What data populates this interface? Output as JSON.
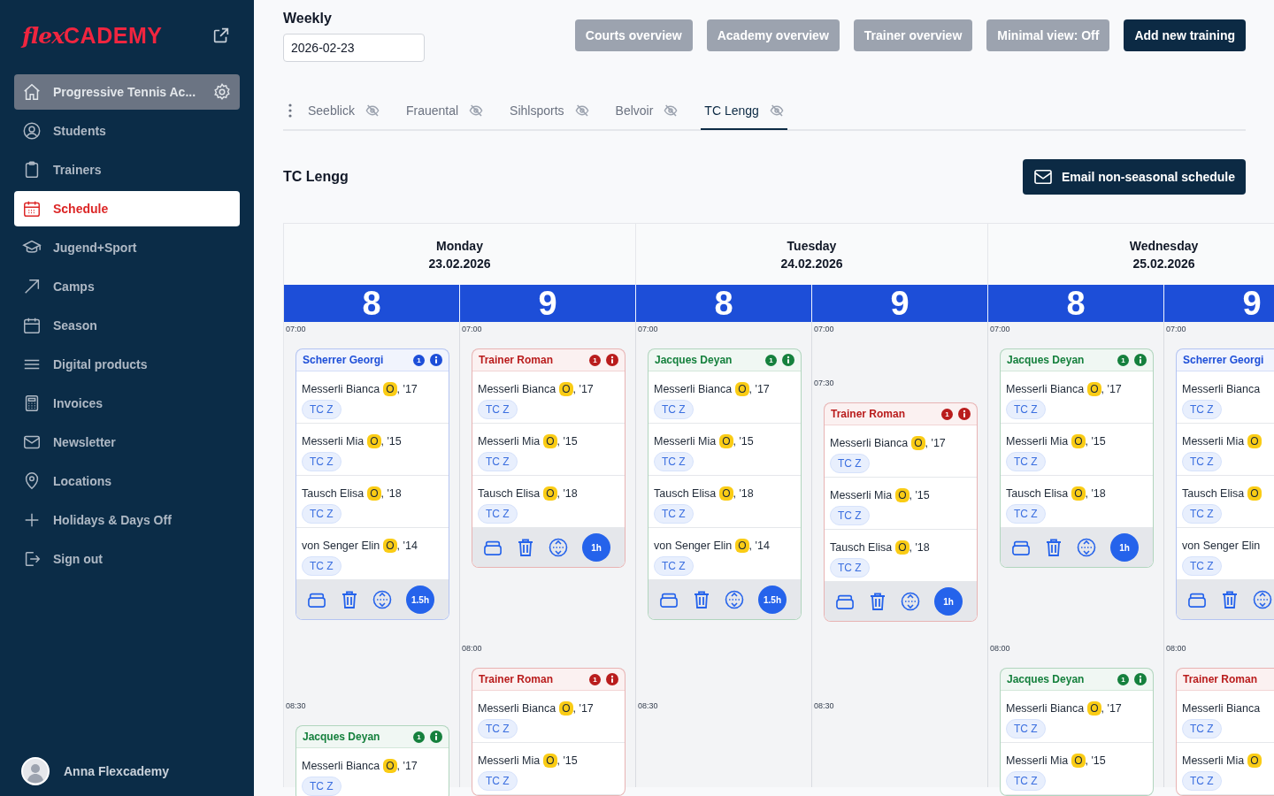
{
  "sidebar": {
    "logo_script": "flex",
    "logo_bold": "CADEMY",
    "organization": {
      "label": "Progressive Tennis Ac..."
    },
    "items": [
      {
        "label": "Students",
        "selected": false
      },
      {
        "label": "Trainers",
        "selected": false
      },
      {
        "label": "Schedule",
        "selected": true
      },
      {
        "label": "Jugend+Sport",
        "selected": false
      },
      {
        "label": "Camps",
        "selected": false
      },
      {
        "label": "Season",
        "selected": false
      },
      {
        "label": "Digital products",
        "selected": false
      },
      {
        "label": "Invoices",
        "selected": false
      },
      {
        "label": "Newsletter",
        "selected": false
      },
      {
        "label": "Locations",
        "selected": false
      },
      {
        "label": "Holidays & Days Off",
        "selected": false
      },
      {
        "label": "Sign out",
        "selected": false
      }
    ],
    "user": "Anna Flexcademy"
  },
  "toolbar": {
    "view_label": "Weekly",
    "date": "2026-02-23",
    "buttons": [
      {
        "label": "Courts overview",
        "kind": "secondary"
      },
      {
        "label": "Academy overview",
        "kind": "secondary"
      },
      {
        "label": "Trainer overview",
        "kind": "secondary"
      },
      {
        "label": "Minimal view: Off",
        "kind": "secondary"
      },
      {
        "label": "Add new training",
        "kind": "primary"
      }
    ]
  },
  "tabs": [
    {
      "label": "Seeblick",
      "selected": false
    },
    {
      "label": "Frauental",
      "selected": false
    },
    {
      "label": "Sihlsports",
      "selected": false
    },
    {
      "label": "Belvoir",
      "selected": false
    },
    {
      "label": "TC Lengg",
      "selected": true
    }
  ],
  "section": {
    "title": "TC Lengg",
    "email_button": "Email non-seasonal schedule"
  },
  "days": [
    {
      "name": "Monday",
      "date": "23.02.2026",
      "courts": [
        {
          "number": "8",
          "slots": [
            {
              "kind": "labeled",
              "time": "07:00",
              "card": {
                "trainer": "Scherrer Georgi",
                "color": "#1d4ed8",
                "count": "1",
                "footer": true,
                "duration": "1.5h",
                "students": [
                  {
                    "name": "Messerli Bianca",
                    "badge": "O",
                    "year": ", '17",
                    "course": "TC Z"
                  },
                  {
                    "name": "Messerli Mia",
                    "badge": "O",
                    "year": ", '15",
                    "course": "TC Z"
                  },
                  {
                    "name": "Tausch Elisa",
                    "badge": "O",
                    "year": ", '18",
                    "course": "TC Z"
                  },
                  {
                    "name": "von Senger Elin",
                    "badge": "O",
                    "year": ", '14",
                    "course": "TC Z"
                  }
                ]
              }
            },
            {
              "kind": "covered"
            },
            {
              "kind": "covered"
            },
            {
              "kind": "labeled",
              "time": "08:30",
              "card": {
                "trainer": "Jacques Deyan",
                "color": "#15803d",
                "count": "1",
                "footer": false,
                "students": [
                  {
                    "name": "Messerli Bianca",
                    "badge": "O",
                    "year": ", '17",
                    "course": "TC Z"
                  }
                ]
              }
            }
          ]
        },
        {
          "number": "9",
          "slots": [
            {
              "kind": "labeled",
              "time": "07:00",
              "card": {
                "trainer": "Trainer Roman",
                "color": "#b91c1c",
                "count": "1",
                "footer": true,
                "duration": "1h",
                "students": [
                  {
                    "name": "Messerli Bianca",
                    "badge": "O",
                    "year": ", '17",
                    "course": "TC Z"
                  },
                  {
                    "name": "Messerli Mia",
                    "badge": "O",
                    "year": ", '15",
                    "course": "TC Z"
                  },
                  {
                    "name": "Tausch Elisa",
                    "badge": "O",
                    "year": ", '18",
                    "course": "TC Z"
                  }
                ]
              }
            },
            {
              "kind": "covered"
            },
            {
              "kind": "labeled",
              "time": "08:00",
              "card": {
                "trainer": "Trainer Roman",
                "color": "#b91c1c",
                "count": "1",
                "footer": false,
                "students": [
                  {
                    "name": "Messerli Bianca",
                    "badge": "O",
                    "year": ", '17",
                    "course": "TC Z"
                  },
                  {
                    "name": "Messerli Mia",
                    "badge": "O",
                    "year": ", '15",
                    "course": "TC Z"
                  }
                ]
              }
            }
          ]
        }
      ]
    },
    {
      "name": "Tuesday",
      "date": "24.02.2026",
      "courts": [
        {
          "number": "8",
          "slots": [
            {
              "kind": "labeled",
              "time": "07:00",
              "card": {
                "trainer": "Jacques Deyan",
                "color": "#15803d",
                "count": "1",
                "footer": true,
                "duration": "1.5h",
                "students": [
                  {
                    "name": "Messerli Bianca",
                    "badge": "O",
                    "year": ", '17",
                    "course": "TC Z"
                  },
                  {
                    "name": "Messerli Mia",
                    "badge": "O",
                    "year": ", '15",
                    "course": "TC Z"
                  },
                  {
                    "name": "Tausch Elisa",
                    "badge": "O",
                    "year": ", '18",
                    "course": "TC Z"
                  },
                  {
                    "name": "von Senger Elin",
                    "badge": "O",
                    "year": ", '14",
                    "course": "TC Z"
                  }
                ]
              }
            },
            {
              "kind": "covered"
            },
            {
              "kind": "covered"
            },
            {
              "kind": "labeled",
              "time": "08:30"
            }
          ]
        },
        {
          "number": "9",
          "slots": [
            {
              "kind": "labeled",
              "time": "07:00"
            },
            {
              "kind": "labeled",
              "time": "07:30",
              "card": {
                "trainer": "Trainer Roman",
                "color": "#b91c1c",
                "count": "1",
                "footer": true,
                "duration": "1h",
                "students": [
                  {
                    "name": "Messerli Bianca",
                    "badge": "O",
                    "year": ", '17",
                    "course": "TC Z"
                  },
                  {
                    "name": "Messerli Mia",
                    "badge": "O",
                    "year": ", '15",
                    "course": "TC Z"
                  },
                  {
                    "name": "Tausch Elisa",
                    "badge": "O",
                    "year": ", '18",
                    "course": "TC Z"
                  }
                ]
              }
            },
            {
              "kind": "covered"
            },
            {
              "kind": "labeled",
              "time": "08:30"
            }
          ]
        }
      ]
    },
    {
      "name": "Wednesday",
      "date": "25.02.2026",
      "courts": [
        {
          "number": "8",
          "slots": [
            {
              "kind": "labeled",
              "time": "07:00",
              "card": {
                "trainer": "Jacques Deyan",
                "color": "#15803d",
                "count": "1",
                "footer": true,
                "duration": "1h",
                "students": [
                  {
                    "name": "Messerli Bianca",
                    "badge": "O",
                    "year": ", '17",
                    "course": "TC Z"
                  },
                  {
                    "name": "Messerli Mia",
                    "badge": "O",
                    "year": ", '15",
                    "course": "TC Z"
                  },
                  {
                    "name": "Tausch Elisa",
                    "badge": "O",
                    "year": ", '18",
                    "course": "TC Z"
                  }
                ]
              }
            },
            {
              "kind": "covered"
            },
            {
              "kind": "labeled",
              "time": "08:00",
              "card": {
                "trainer": "Jacques Deyan",
                "color": "#15803d",
                "count": "1",
                "footer": false,
                "students": [
                  {
                    "name": "Messerli Bianca",
                    "badge": "O",
                    "year": ", '17",
                    "course": "TC Z"
                  },
                  {
                    "name": "Messerli Mia",
                    "badge": "O",
                    "year": ", '15",
                    "course": "TC Z"
                  }
                ]
              }
            }
          ]
        },
        {
          "number": "9",
          "slots": [
            {
              "kind": "labeled",
              "time": "07:00",
              "card": {
                "trainer": "Scherrer Georgi",
                "color": "#1d4ed8",
                "footer": true,
                "students": [
                  {
                    "name": "Messerli Bianca",
                    "course": "TC Z"
                  },
                  {
                    "name": "Messerli Mia",
                    "badge": "O",
                    "course": "TC Z"
                  },
                  {
                    "name": "Tausch Elisa",
                    "badge": "O",
                    "course": "TC Z"
                  },
                  {
                    "name": "von Senger Elin",
                    "course": "TC Z"
                  }
                ]
              }
            },
            {
              "kind": "covered"
            },
            {
              "kind": "labeled",
              "time": "08:00",
              "card": {
                "trainer": "Trainer Roman",
                "color": "#b91c1c",
                "footer": false,
                "students": [
                  {
                    "name": "Messerli Bianca",
                    "course": "TC Z"
                  },
                  {
                    "name": "Messerli Mia",
                    "badge": "O",
                    "course": "TC Z"
                  }
                ]
              }
            }
          ]
        }
      ]
    }
  ]
}
